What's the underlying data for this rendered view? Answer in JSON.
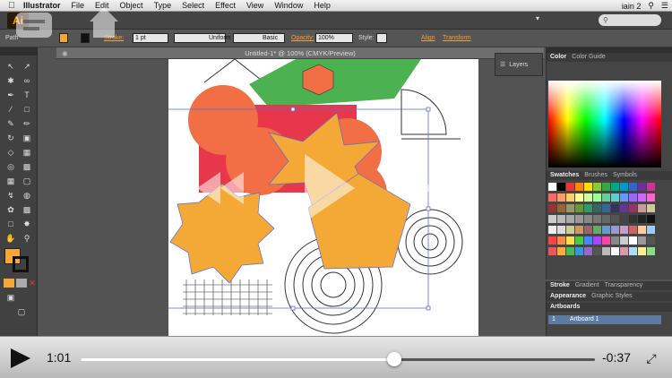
{
  "menubar": {
    "app": "Illustrator",
    "items": [
      "File",
      "Edit",
      "Object",
      "Type",
      "Select",
      "Effect",
      "View",
      "Window",
      "Help"
    ],
    "user": "iain 2"
  },
  "appbar": {
    "logo": "Ai"
  },
  "control": {
    "selection": "Path",
    "stroke_label": "Stroke:",
    "stroke_weight": "1 pt",
    "profile": "Uniform",
    "brush": "Basic",
    "opacity_label": "Opacity:",
    "opacity": "100%",
    "style_label": "Style:",
    "align": "Align",
    "transform": "Transform"
  },
  "document": {
    "tab_title": "Untitled-1* @ 100% (CMYK/Preview)"
  },
  "layers_panel": {
    "label": "Layers"
  },
  "color_panel": {
    "tabs": [
      "Color",
      "Color Guide"
    ]
  },
  "swatches_panel": {
    "tabs": [
      "Swatches",
      "Brushes",
      "Symbols"
    ]
  },
  "stroke_panel": {
    "tabs": [
      "Stroke",
      "Gradient",
      "Transparency"
    ]
  },
  "appearance_panel": {
    "tabs": [
      "Appearance",
      "Graphic Styles"
    ]
  },
  "artboards_panel": {
    "title": "Artboards",
    "row_number": "1",
    "row_name": "Artboard 1"
  },
  "player": {
    "elapsed": "1:01",
    "remaining": "-0:37",
    "progress": 0.61
  },
  "colors": {
    "orange_fill": "#f4a835",
    "red_orange": "#f26e45",
    "crimson": "#e8374a",
    "green": "#4cb251",
    "selection_blue": "#5b6cd6",
    "ai_orange": "#ff9a00"
  },
  "icons": [
    "apple-icon",
    "home-icon",
    "chat-icon",
    "play-icon",
    "fullscreen-icon",
    "layers-icon",
    "search-icon"
  ]
}
